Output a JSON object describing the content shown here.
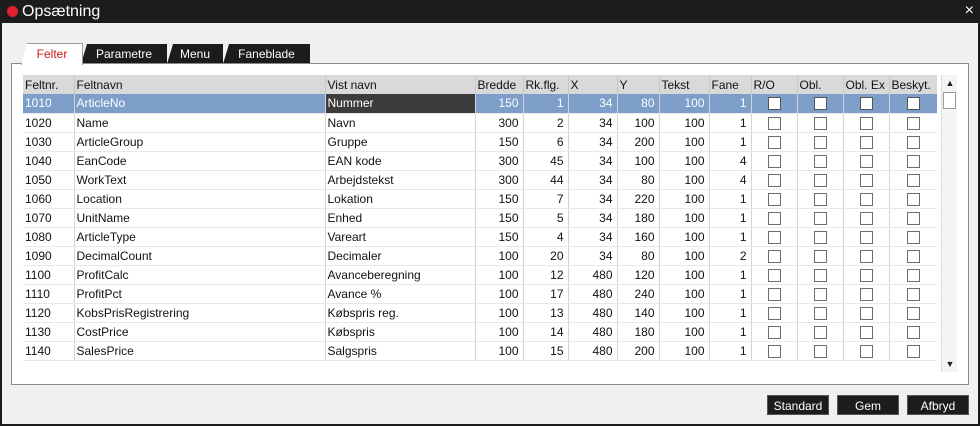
{
  "window": {
    "title": "Opsætning",
    "close_glyph": "×",
    "close_icon": "close-icon"
  },
  "tabs": [
    {
      "label": "Felter",
      "active": true
    },
    {
      "label": "Parametre",
      "active": false
    },
    {
      "label": "Menu",
      "active": false
    },
    {
      "label": "Faneblade",
      "active": false
    }
  ],
  "columns": [
    "Feltnr.",
    "Feltnavn",
    "Vist navn",
    "Bredde",
    "Rk.flg.",
    "X",
    "Y",
    "Tekst",
    "Fane",
    "R/O",
    "Obl.",
    "Obl. Ex",
    "Beskyt."
  ],
  "rows": [
    {
      "nr": "1010",
      "navn": "ArticleNo",
      "vist": "Nummer",
      "bredde": "150",
      "rk": "1",
      "x": "34",
      "y": "80",
      "tekst": "100",
      "fane": "1",
      "selected": true
    },
    {
      "nr": "1020",
      "navn": "Name",
      "vist": "Navn",
      "bredde": "300",
      "rk": "2",
      "x": "34",
      "y": "100",
      "tekst": "100",
      "fane": "1"
    },
    {
      "nr": "1030",
      "navn": "ArticleGroup",
      "vist": "Gruppe",
      "bredde": "150",
      "rk": "6",
      "x": "34",
      "y": "200",
      "tekst": "100",
      "fane": "1"
    },
    {
      "nr": "1040",
      "navn": "EanCode",
      "vist": "EAN kode",
      "bredde": "300",
      "rk": "45",
      "x": "34",
      "y": "100",
      "tekst": "100",
      "fane": "4"
    },
    {
      "nr": "1050",
      "navn": "WorkText",
      "vist": "Arbejdstekst",
      "bredde": "300",
      "rk": "44",
      "x": "34",
      "y": "80",
      "tekst": "100",
      "fane": "4"
    },
    {
      "nr": "1060",
      "navn": "Location",
      "vist": "Lokation",
      "bredde": "150",
      "rk": "7",
      "x": "34",
      "y": "220",
      "tekst": "100",
      "fane": "1"
    },
    {
      "nr": "1070",
      "navn": "UnitName",
      "vist": "Enhed",
      "bredde": "150",
      "rk": "5",
      "x": "34",
      "y": "180",
      "tekst": "100",
      "fane": "1"
    },
    {
      "nr": "1080",
      "navn": "ArticleType",
      "vist": "Vareart",
      "bredde": "150",
      "rk": "4",
      "x": "34",
      "y": "160",
      "tekst": "100",
      "fane": "1"
    },
    {
      "nr": "1090",
      "navn": "DecimalCount",
      "vist": "Decimaler",
      "bredde": "100",
      "rk": "20",
      "x": "34",
      "y": "80",
      "tekst": "100",
      "fane": "2"
    },
    {
      "nr": "1100",
      "navn": "ProfitCalc",
      "vist": "Avanceberegning",
      "bredde": "100",
      "rk": "12",
      "x": "480",
      "y": "120",
      "tekst": "100",
      "fane": "1"
    },
    {
      "nr": "1110",
      "navn": "ProfitPct",
      "vist": "Avance %",
      "bredde": "100",
      "rk": "17",
      "x": "480",
      "y": "240",
      "tekst": "100",
      "fane": "1"
    },
    {
      "nr": "1120",
      "navn": "KobsPrisRegistrering",
      "vist": "Købspris reg.",
      "bredde": "100",
      "rk": "13",
      "x": "480",
      "y": "140",
      "tekst": "100",
      "fane": "1"
    },
    {
      "nr": "1130",
      "navn": "CostPrice",
      "vist": "Købspris",
      "bredde": "100",
      "rk": "14",
      "x": "480",
      "y": "180",
      "tekst": "100",
      "fane": "1"
    },
    {
      "nr": "1140",
      "navn": "SalesPrice",
      "vist": "Salgspris",
      "bredde": "100",
      "rk": "15",
      "x": "480",
      "y": "200",
      "tekst": "100",
      "fane": "1"
    }
  ],
  "scrollbar": {
    "up_glyph": "▲",
    "down_glyph": "▼"
  },
  "buttons": {
    "standard": "Standard",
    "gem": "Gem",
    "afbryd": "Afbryd"
  }
}
